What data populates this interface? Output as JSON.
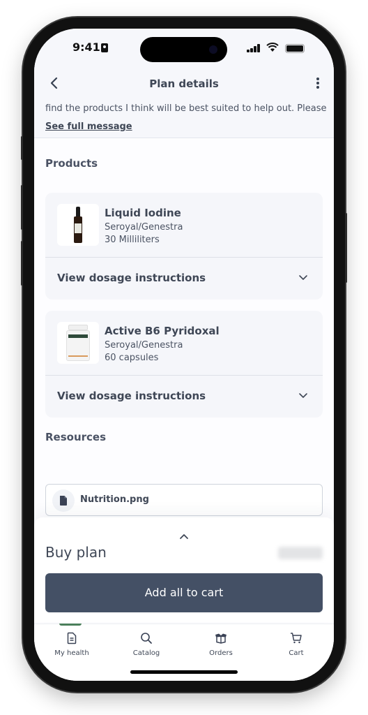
{
  "status_bar": {
    "time": "9:41"
  },
  "header": {
    "title": "Plan details"
  },
  "message": {
    "text": "find the products I think will be best suited to help out. Please",
    "link_label": "See full message"
  },
  "products": {
    "title": "Products",
    "items": [
      {
        "name": "Liquid Iodine",
        "brand": "Seroyal/Genestra",
        "size": "30 Milliliters",
        "dosage_label": "View dosage instructions"
      },
      {
        "name": "Active B6 Pyridoxal",
        "brand": "Seroyal/Genestra",
        "size": "60 capsules",
        "dosage_label": "View dosage instructions"
      }
    ]
  },
  "resources": {
    "title": "Resources",
    "items": [
      {
        "name": "Nutrition.png",
        "icon": "file-icon"
      }
    ]
  },
  "annotation": {
    "color": "#c8334a"
  },
  "buy_plan": {
    "title": "Buy plan",
    "price": "",
    "button_label": "Add all to cart"
  },
  "tab_bar": {
    "active_color": "#4b7f5b",
    "items": [
      {
        "label": "My health",
        "icon": "document-icon",
        "active": true
      },
      {
        "label": "Catalog",
        "icon": "search-icon",
        "active": false
      },
      {
        "label": "Orders",
        "icon": "box-icon",
        "active": false
      },
      {
        "label": "Cart",
        "icon": "cart-icon",
        "active": false
      }
    ]
  }
}
